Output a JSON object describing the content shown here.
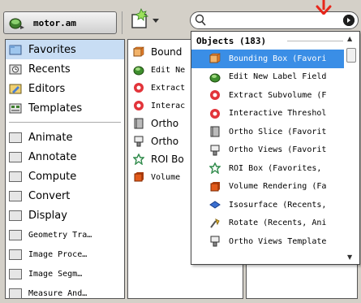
{
  "toolbar": {
    "file_label": "motor.am",
    "search_placeholder": "",
    "clear_symbol": "●"
  },
  "categories": {
    "group1": [
      {
        "label": "Favorites",
        "icon": "favorites-icon",
        "selected": true
      },
      {
        "label": "Recents",
        "icon": "recents-icon"
      },
      {
        "label": "Editors",
        "icon": "editors-icon"
      },
      {
        "label": "Templates",
        "icon": "templates-icon"
      }
    ],
    "group2": [
      {
        "label": "Animate"
      },
      {
        "label": "Annotate"
      },
      {
        "label": "Compute"
      },
      {
        "label": "Convert"
      },
      {
        "label": "Display"
      },
      {
        "label": "Geometry Tra…"
      },
      {
        "label": "Image Proce…"
      },
      {
        "label": "Image Segm…"
      },
      {
        "label": "Measure And…"
      }
    ]
  },
  "objects": [
    {
      "label": "Bound",
      "icon": "bounding-box-icon"
    },
    {
      "label": "Edit Ne",
      "icon": "label-field-icon"
    },
    {
      "label": "Extract",
      "icon": "subvolume-icon"
    },
    {
      "label": "Interac",
      "icon": "threshold-icon"
    },
    {
      "label": "Ortho",
      "icon": "ortho-slice-icon"
    },
    {
      "label": "Ortho",
      "icon": "ortho-views-icon"
    },
    {
      "label": "ROI Bo",
      "icon": "roi-box-icon"
    },
    {
      "label": "Volume",
      "icon": "volume-rendering-icon"
    }
  ],
  "dropdown": {
    "header": "Objects (183)",
    "items": [
      {
        "label": "Bounding Box (Favori",
        "icon": "bounding-box-icon",
        "active": true
      },
      {
        "label": "Edit New Label Field",
        "icon": "label-field-icon"
      },
      {
        "label": "Extract Subvolume (F",
        "icon": "subvolume-icon"
      },
      {
        "label": "Interactive Threshol",
        "icon": "threshold-icon"
      },
      {
        "label": "Ortho Slice (Favorit",
        "icon": "ortho-slice-icon"
      },
      {
        "label": "Ortho Views (Favorit",
        "icon": "ortho-views-icon"
      },
      {
        "label": "ROI Box (Favorites,",
        "icon": "roi-box-icon"
      },
      {
        "label": "Volume Rendering (Fa",
        "icon": "volume-rendering-icon"
      },
      {
        "label": "Isosurface (Recents,",
        "icon": "isosurface-icon"
      },
      {
        "label": "Rotate (Recents, Ani",
        "icon": "rotate-icon"
      },
      {
        "label": "Ortho Views Template",
        "icon": "ortho-views-icon"
      }
    ]
  },
  "colors": {
    "accent": "#3a8ee6",
    "arrow": "#e8261b",
    "selected_bg": "#c8ddf4"
  }
}
